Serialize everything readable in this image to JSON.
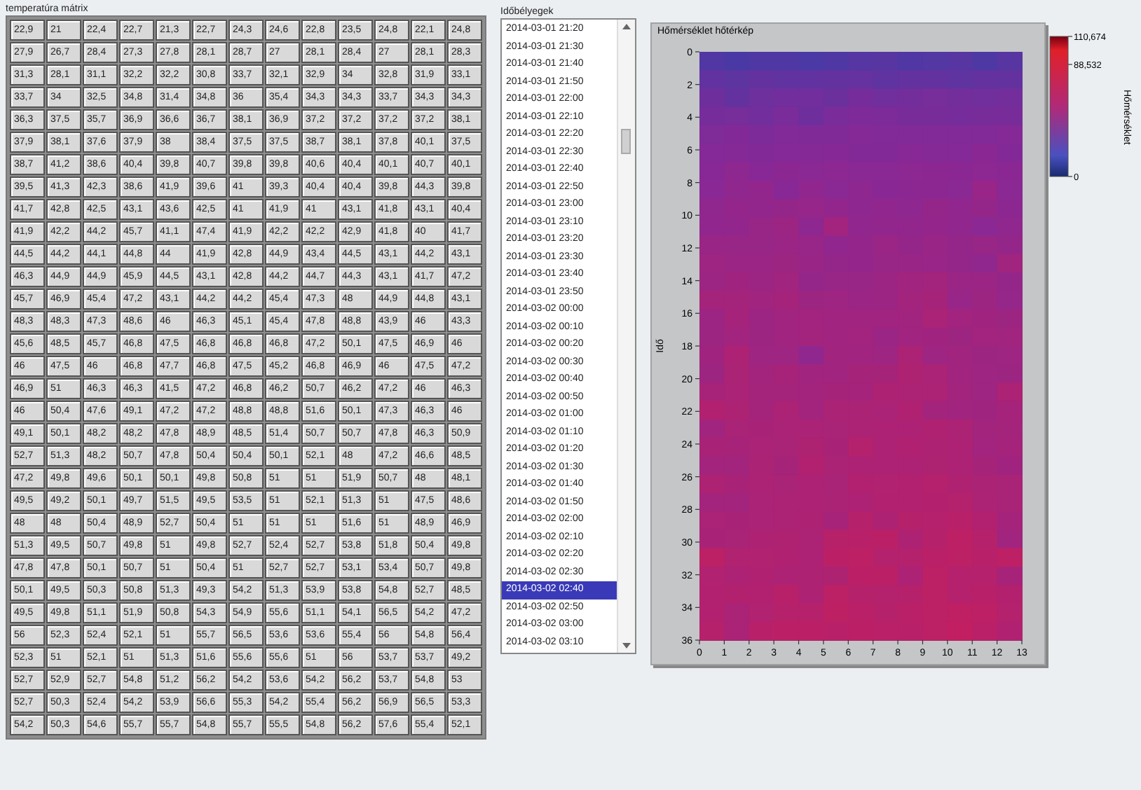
{
  "matrix": {
    "title": "temperatúra mátrix",
    "rows": [
      [
        "22,9",
        "21",
        "22,4",
        "22,7",
        "21,3",
        "22,7",
        "24,3",
        "24,6",
        "22,8",
        "23,5",
        "24,8",
        "22,1",
        "24,8"
      ],
      [
        "27,9",
        "26,7",
        "28,4",
        "27,3",
        "27,8",
        "28,1",
        "28,7",
        "27",
        "28,1",
        "28,4",
        "27",
        "28,1",
        "28,3"
      ],
      [
        "31,3",
        "28,1",
        "31,1",
        "32,2",
        "32,2",
        "30,8",
        "33,7",
        "32,1",
        "32,9",
        "34",
        "32,8",
        "31,9",
        "33,1"
      ],
      [
        "33,7",
        "34",
        "32,5",
        "34,8",
        "31,4",
        "34,8",
        "36",
        "35,4",
        "34,3",
        "34,3",
        "33,7",
        "34,3",
        "34,3"
      ],
      [
        "36,3",
        "37,5",
        "35,7",
        "36,9",
        "36,6",
        "36,7",
        "38,1",
        "36,9",
        "37,2",
        "37,2",
        "37,2",
        "37,2",
        "38,1"
      ],
      [
        "37,9",
        "38,1",
        "37,6",
        "37,9",
        "38",
        "38,4",
        "37,5",
        "37,5",
        "38,7",
        "38,1",
        "37,8",
        "40,1",
        "37,5"
      ],
      [
        "38,7",
        "41,2",
        "38,6",
        "40,4",
        "39,8",
        "40,7",
        "39,8",
        "39,8",
        "40,6",
        "40,4",
        "40,1",
        "40,7",
        "40,1"
      ],
      [
        "39,5",
        "41,3",
        "42,3",
        "38,6",
        "41,9",
        "39,6",
        "41",
        "39,3",
        "40,4",
        "40,4",
        "39,8",
        "44,3",
        "39,8"
      ],
      [
        "41,7",
        "42,8",
        "42,5",
        "43,1",
        "43,6",
        "42,5",
        "41",
        "41,9",
        "41",
        "43,1",
        "41,8",
        "43,1",
        "40,4"
      ],
      [
        "41,9",
        "42,2",
        "44,2",
        "45,7",
        "41,1",
        "47,4",
        "41,9",
        "42,2",
        "42,2",
        "42,9",
        "41,8",
        "40",
        "41,7"
      ],
      [
        "44,5",
        "44,2",
        "44,1",
        "44,8",
        "44",
        "41,9",
        "42,8",
        "44,9",
        "43,4",
        "44,5",
        "43,1",
        "44,2",
        "43,1"
      ],
      [
        "46,3",
        "44,9",
        "44,9",
        "45,9",
        "44,5",
        "43,1",
        "42,8",
        "44,2",
        "44,7",
        "44,3",
        "43,1",
        "41,7",
        "47,2"
      ],
      [
        "45,7",
        "46,9",
        "45,4",
        "47,2",
        "43,1",
        "44,2",
        "44,2",
        "45,4",
        "47,3",
        "48",
        "44,9",
        "44,8",
        "43,1"
      ],
      [
        "48,3",
        "48,3",
        "47,3",
        "48,6",
        "46",
        "46,3",
        "45,1",
        "45,4",
        "47,8",
        "48,8",
        "43,9",
        "46",
        "43,3"
      ],
      [
        "45,6",
        "48,5",
        "45,7",
        "46,8",
        "47,5",
        "46,8",
        "46,8",
        "46,8",
        "47,2",
        "50,1",
        "47,5",
        "46,9",
        "46"
      ],
      [
        "46",
        "47,5",
        "46",
        "46,8",
        "47,7",
        "46,8",
        "47,5",
        "45,2",
        "46,8",
        "46,9",
        "46",
        "47,5",
        "47,2"
      ],
      [
        "46,9",
        "51",
        "46,3",
        "46,3",
        "41,5",
        "47,2",
        "46,8",
        "46,2",
        "50,7",
        "46,2",
        "47,2",
        "46",
        "46,3"
      ],
      [
        "46",
        "50,4",
        "47,6",
        "49,1",
        "47,2",
        "47,2",
        "48,8",
        "48,8",
        "51,6",
        "50,1",
        "47,3",
        "46,3",
        "46"
      ],
      [
        "49,1",
        "50,1",
        "48,2",
        "48,2",
        "47,8",
        "48,9",
        "48,5",
        "51,4",
        "50,7",
        "50,7",
        "47,8",
        "46,3",
        "50,9"
      ],
      [
        "52,7",
        "51,3",
        "48,2",
        "50,7",
        "47,8",
        "50,4",
        "50,4",
        "50,1",
        "52,1",
        "48",
        "47,2",
        "46,6",
        "48,5"
      ],
      [
        "47,2",
        "49,8",
        "49,6",
        "50,1",
        "50,1",
        "49,8",
        "50,8",
        "51",
        "51",
        "51,9",
        "50,7",
        "48",
        "48,1"
      ],
      [
        "49,5",
        "49,2",
        "50,1",
        "49,7",
        "51,5",
        "49,5",
        "53,5",
        "51",
        "52,1",
        "51,3",
        "51",
        "47,5",
        "48,6"
      ],
      [
        "48",
        "48",
        "50,4",
        "48,9",
        "52,7",
        "50,4",
        "51",
        "51",
        "51",
        "51,6",
        "51",
        "48,9",
        "46,9"
      ],
      [
        "51,3",
        "49,5",
        "50,7",
        "49,8",
        "51",
        "49,8",
        "52,7",
        "52,4",
        "52,7",
        "53,8",
        "51,8",
        "50,4",
        "49,8"
      ],
      [
        "47,8",
        "47,8",
        "50,1",
        "50,7",
        "51",
        "50,4",
        "51",
        "52,7",
        "52,7",
        "53,1",
        "53,4",
        "50,7",
        "49,8"
      ],
      [
        "50,1",
        "49,5",
        "50,3",
        "50,8",
        "51,3",
        "49,3",
        "54,2",
        "51,3",
        "53,9",
        "53,8",
        "54,8",
        "52,7",
        "48,5"
      ],
      [
        "49,5",
        "49,8",
        "51,1",
        "51,9",
        "50,8",
        "54,3",
        "54,9",
        "55,6",
        "51,1",
        "54,1",
        "56,5",
        "54,2",
        "47,2"
      ],
      [
        "56",
        "52,3",
        "52,4",
        "52,1",
        "51",
        "55,7",
        "56,5",
        "53,6",
        "53,6",
        "55,4",
        "56",
        "54,8",
        "56,4"
      ],
      [
        "52,3",
        "51",
        "52,1",
        "51",
        "51,3",
        "51,6",
        "55,6",
        "55,6",
        "51",
        "56",
        "53,7",
        "53,7",
        "49,2"
      ],
      [
        "52,7",
        "52,9",
        "52,7",
        "54,8",
        "51,2",
        "56,2",
        "54,2",
        "53,6",
        "54,2",
        "56,2",
        "53,7",
        "54,8",
        "53"
      ],
      [
        "52,7",
        "50,3",
        "52,4",
        "54,2",
        "53,9",
        "56,6",
        "55,3",
        "54,2",
        "55,4",
        "56,2",
        "56,9",
        "56,5",
        "53,3"
      ],
      [
        "54,2",
        "50,3",
        "54,6",
        "55,7",
        "55,7",
        "54,8",
        "55,7",
        "55,5",
        "54,8",
        "56,2",
        "57,6",
        "55,4",
        "52,1"
      ]
    ]
  },
  "timestamps": {
    "label": "Időbélyegek",
    "items": [
      {
        "label": "2014-03-01 21:20",
        "selected": false
      },
      {
        "label": "2014-03-01 21:30",
        "selected": false
      },
      {
        "label": "2014-03-01 21:40",
        "selected": false
      },
      {
        "label": "2014-03-01 21:50",
        "selected": false
      },
      {
        "label": "2014-03-01 22:00",
        "selected": false
      },
      {
        "label": "2014-03-01 22:10",
        "selected": false
      },
      {
        "label": "2014-03-01 22:20",
        "selected": false
      },
      {
        "label": "2014-03-01 22:30",
        "selected": false
      },
      {
        "label": "2014-03-01 22:40",
        "selected": false
      },
      {
        "label": "2014-03-01 22:50",
        "selected": false
      },
      {
        "label": "2014-03-01 23:00",
        "selected": false
      },
      {
        "label": "2014-03-01 23:10",
        "selected": false
      },
      {
        "label": "2014-03-01 23:20",
        "selected": false
      },
      {
        "label": "2014-03-01 23:30",
        "selected": false
      },
      {
        "label": "2014-03-01 23:40",
        "selected": false
      },
      {
        "label": "2014-03-01 23:50",
        "selected": false
      },
      {
        "label": "2014-03-02 00:00",
        "selected": false
      },
      {
        "label": "2014-03-02 00:10",
        "selected": false
      },
      {
        "label": "2014-03-02 00:20",
        "selected": false
      },
      {
        "label": "2014-03-02 00:30",
        "selected": false
      },
      {
        "label": "2014-03-02 00:40",
        "selected": false
      },
      {
        "label": "2014-03-02 00:50",
        "selected": false
      },
      {
        "label": "2014-03-02 01:00",
        "selected": false
      },
      {
        "label": "2014-03-02 01:10",
        "selected": false
      },
      {
        "label": "2014-03-02 01:20",
        "selected": false
      },
      {
        "label": "2014-03-02 01:30",
        "selected": false
      },
      {
        "label": "2014-03-02 01:40",
        "selected": false
      },
      {
        "label": "2014-03-02 01:50",
        "selected": false
      },
      {
        "label": "2014-03-02 02:00",
        "selected": false
      },
      {
        "label": "2014-03-02 02:10",
        "selected": false
      },
      {
        "label": "2014-03-02 02:20",
        "selected": false
      },
      {
        "label": "2014-03-02 02:30",
        "selected": false
      },
      {
        "label": "2014-03-02 02:40",
        "selected": true
      },
      {
        "label": "2014-03-02 02:50",
        "selected": false
      },
      {
        "label": "2014-03-02 03:00",
        "selected": false
      },
      {
        "label": "2014-03-02 03:10",
        "selected": false
      }
    ]
  },
  "heatmap": {
    "title": "Hőmérséklet hőtérkép",
    "y_label": "Idő",
    "y_ticks": [
      "0",
      "2",
      "4",
      "6",
      "8",
      "10",
      "12",
      "14",
      "16",
      "18",
      "20",
      "22",
      "24",
      "26",
      "28",
      "30",
      "32",
      "34",
      "36"
    ],
    "x_ticks": [
      "0",
      "1",
      "2",
      "3",
      "4",
      "5",
      "6",
      "7",
      "8",
      "9",
      "10",
      "11",
      "12",
      "13"
    ]
  },
  "colorbar": {
    "label": "Hőmérséklet",
    "ticks": [
      "110,674",
      "88,532",
      "0"
    ]
  }
}
